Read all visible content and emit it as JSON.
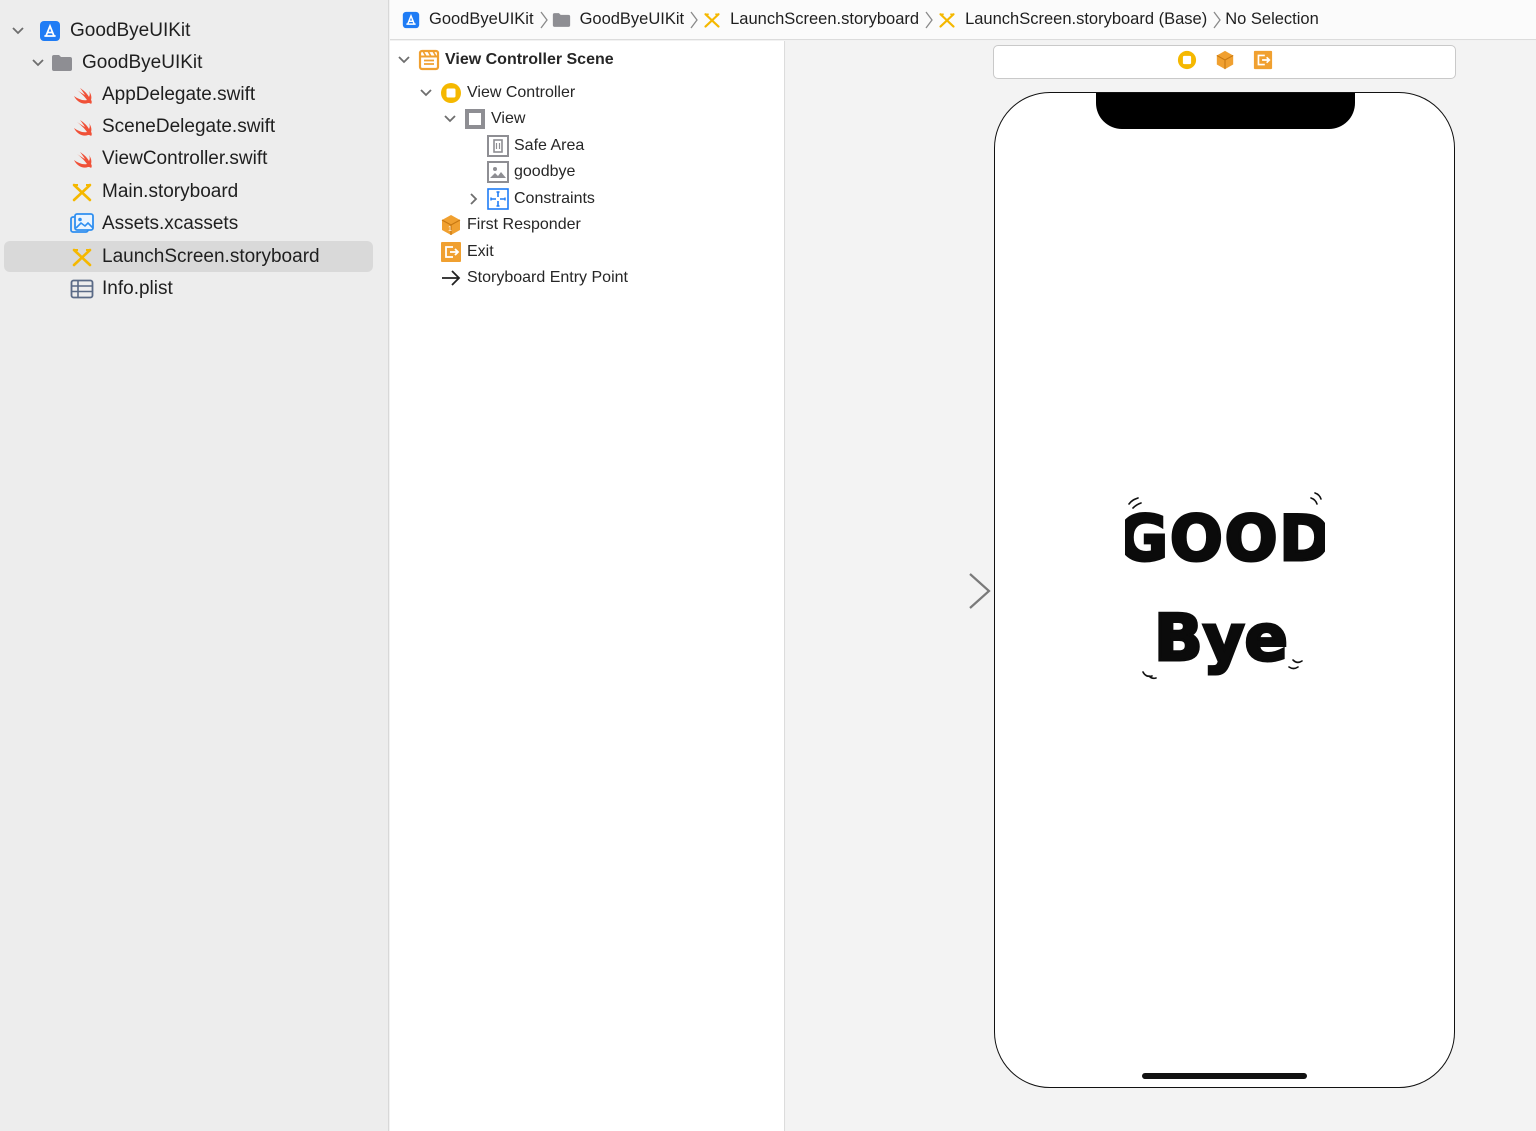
{
  "navigator": {
    "items": [
      {
        "label": "GoodByeUIKit",
        "icon": "app-project-icon",
        "expanded": true,
        "selected": false
      },
      {
        "label": "GoodByeUIKit",
        "icon": "folder-icon",
        "expanded": true,
        "selected": false
      },
      {
        "label": "AppDelegate.swift",
        "icon": "swift-file-icon",
        "selected": false
      },
      {
        "label": "SceneDelegate.swift",
        "icon": "swift-file-icon",
        "selected": false
      },
      {
        "label": "ViewController.swift",
        "icon": "swift-file-icon",
        "selected": false
      },
      {
        "label": "Main.storyboard",
        "icon": "storyboard-icon",
        "selected": false
      },
      {
        "label": "Assets.xcassets",
        "icon": "asset-catalog-icon",
        "selected": false
      },
      {
        "label": "LaunchScreen.storyboard",
        "icon": "storyboard-icon",
        "selected": true
      },
      {
        "label": "Info.plist",
        "icon": "plist-icon",
        "selected": false
      }
    ]
  },
  "breadcrumb": {
    "items": [
      {
        "label": "GoodByeUIKit",
        "icon": "app-project-icon"
      },
      {
        "label": "GoodByeUIKit",
        "icon": "folder-icon"
      },
      {
        "label": "LaunchScreen.storyboard",
        "icon": "storyboard-icon"
      },
      {
        "label": "LaunchScreen.storyboard (Base)",
        "icon": "storyboard-icon"
      },
      {
        "label": "No Selection",
        "icon": ""
      }
    ]
  },
  "outline": {
    "items": [
      {
        "label": "View Controller Scene",
        "icon": "scene-icon",
        "expanded": true
      },
      {
        "label": "View Controller",
        "icon": "view-controller-icon",
        "expanded": true
      },
      {
        "label": "View",
        "icon": "view-icon",
        "expanded": true
      },
      {
        "label": "Safe Area",
        "icon": "safe-area-icon"
      },
      {
        "label": "goodbye",
        "icon": "image-view-icon"
      },
      {
        "label": "Constraints",
        "icon": "constraints-icon",
        "expanded": false
      },
      {
        "label": "First Responder",
        "icon": "first-responder-icon"
      },
      {
        "label": "Exit",
        "icon": "exit-icon"
      },
      {
        "label": "Storyboard Entry Point",
        "icon": "entry-point-arrow-icon"
      }
    ]
  },
  "canvas": {
    "dock_icons": [
      "view-controller-icon",
      "first-responder-icon",
      "exit-icon"
    ],
    "launch_image": {
      "name": "goodbye",
      "line1": "GOOD",
      "line2": "Bye"
    }
  },
  "colors": {
    "selection": "#d9d9d9",
    "swift": "#f05138",
    "storyboard": "#f5b800",
    "xcode_blue": "#1f7cf5",
    "orange": "#f0a030"
  }
}
